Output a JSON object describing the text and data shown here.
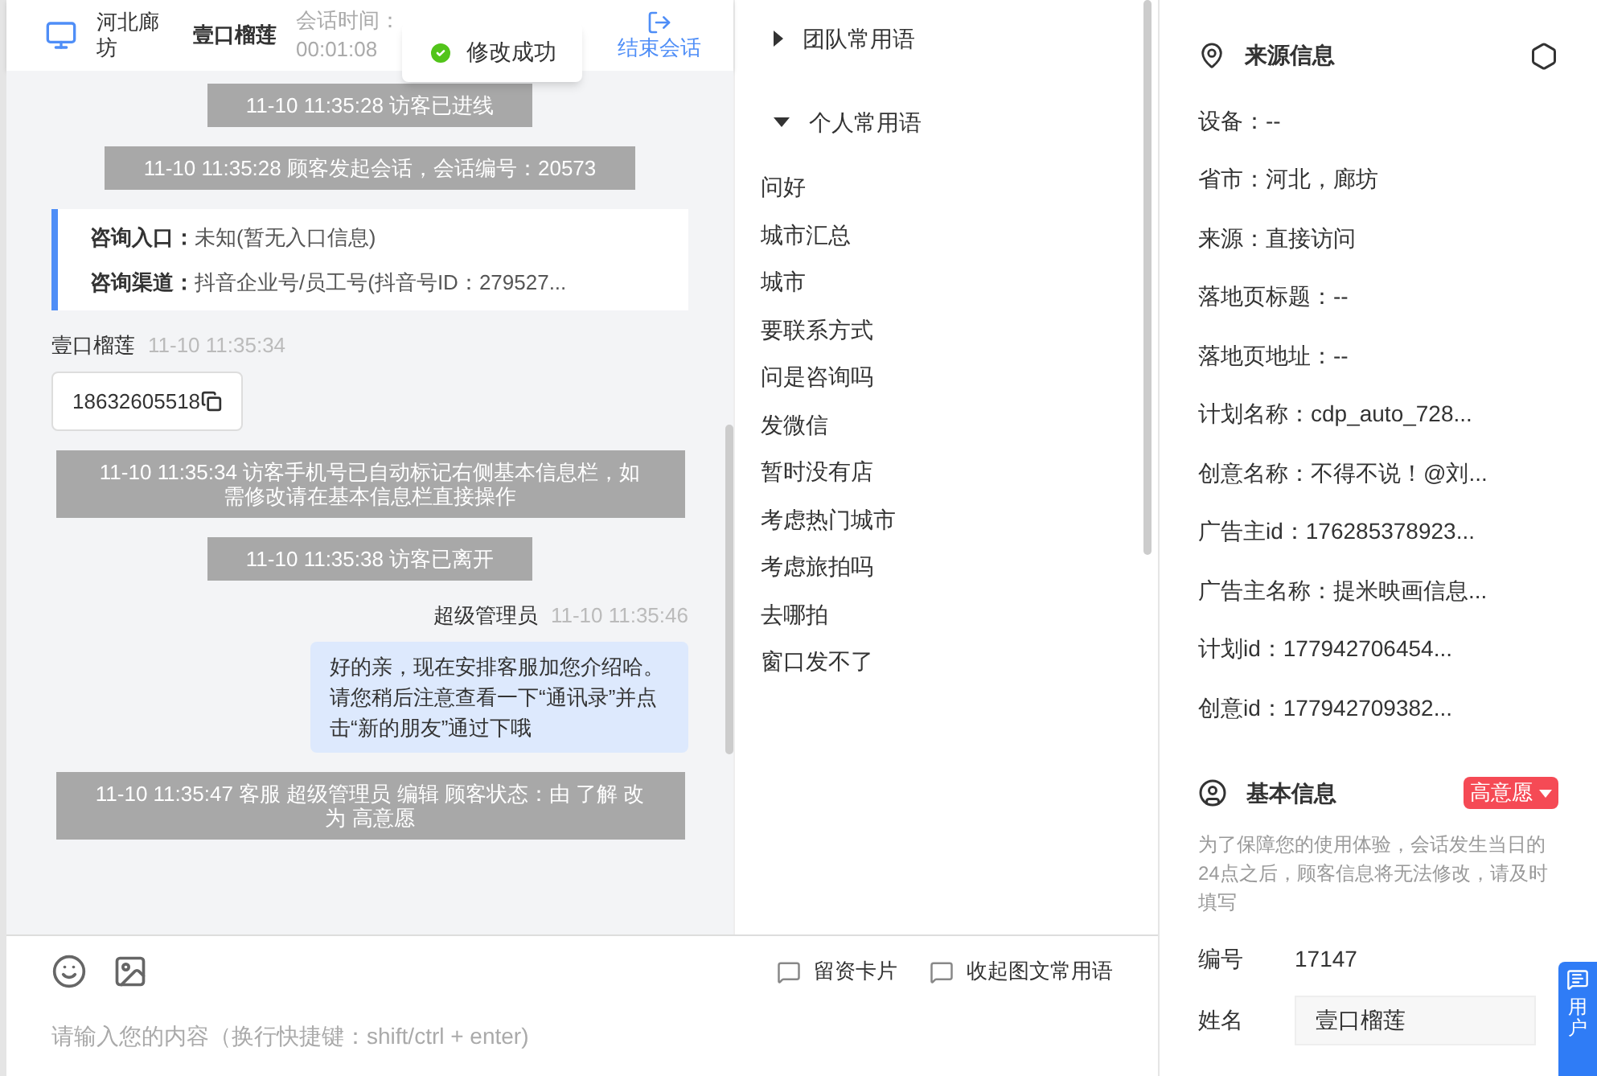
{
  "header": {
    "location": "河北廊坊",
    "visitor": "壹口榴莲",
    "session_time_label": "会话时间：",
    "session_time": "00:01:08",
    "end_label": "结束会话"
  },
  "toast": {
    "text": "修改成功"
  },
  "messages": [
    {
      "kind": "system",
      "text": "11-10 11:35:28 访客已进线"
    },
    {
      "kind": "system",
      "text": "11-10 11:35:28 顾客发起会话，会话编号：20573"
    },
    {
      "kind": "info",
      "lines": [
        {
          "label": "咨询入口：",
          "value": "未知(暂无入口信息)"
        },
        {
          "label": "咨询渠道：",
          "value": "抖音企业号/员工号(抖音号ID：279527..."
        }
      ]
    },
    {
      "kind": "visitor",
      "sender": "壹口榴莲",
      "time": "11-10 11:35:34",
      "text": "18632605518"
    },
    {
      "kind": "system",
      "text": "11-10 11:35:34 访客手机号已自动标记右侧基本信息栏，如需修改请在基本信息栏直接操作"
    },
    {
      "kind": "system",
      "text": "11-10 11:35:38 访客已离开"
    },
    {
      "kind": "agent",
      "sender": "超级管理员",
      "time": "11-10 11:35:46",
      "text": "好的亲，现在安排客服加您介绍哈。请您稍后注意查看一下“通讯录”并点击“新的朋友”通过下哦"
    },
    {
      "kind": "system",
      "text": "11-10 11:35:47 客服 超级管理员 编辑 顾客状态：由 了解 改为 高意愿"
    }
  ],
  "input": {
    "placeholder": "请输入您的内容（换行快捷键：shift/ctrl + enter)"
  },
  "toolbar": [
    "留资卡片",
    "收起图文常用语"
  ],
  "phrases": {
    "groups": [
      {
        "title": "团队常用语",
        "expanded": false
      },
      {
        "title": "个人常用语",
        "expanded": true,
        "items": [
          "问好",
          "城市汇总",
          "城市",
          "要联系方式",
          "问是咨询吗",
          "发微信",
          "暂时没有店",
          "考虑热门城市",
          "考虑旅拍吗",
          "去哪拍",
          "窗口发不了"
        ]
      }
    ]
  },
  "source_info": {
    "title": "来源信息",
    "fields": [
      "设备：--",
      "省市：河北，廊坊",
      "来源：直接访问",
      "落地页标题：--",
      "落地页地址：--",
      "计划名称：cdp_auto_728...",
      "创意名称：不得不说！@刘...",
      "广告主id：176285378923...",
      "广告主名称：提米映画信息...",
      "计划id：177942706454...",
      "创意id：177942709382..."
    ]
  },
  "basic_info": {
    "title": "基本信息",
    "intent": "高意愿",
    "note": "为了保障您的使用体验，会话发生当日的24点之后，顾客信息将无法修改，请及时填写",
    "id_label": "编号",
    "id_value": "17147",
    "name_label": "姓名",
    "name_value": "壹口榴莲"
  },
  "side_tab": {
    "text": "用户"
  }
}
